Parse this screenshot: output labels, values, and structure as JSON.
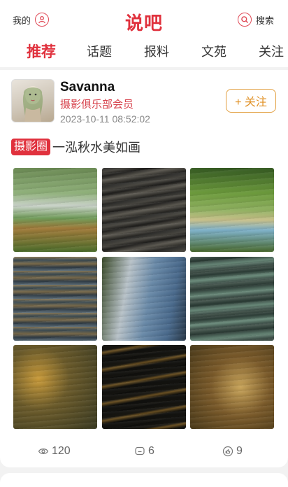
{
  "header": {
    "my_label": "我的",
    "title": "说吧",
    "search_label": "搜索",
    "accent_color": "#e0313d"
  },
  "tabs": [
    {
      "label": "推荐",
      "active": true
    },
    {
      "label": "话题",
      "active": false
    },
    {
      "label": "报料",
      "active": false
    },
    {
      "label": "文苑",
      "active": false
    },
    {
      "label": "关注",
      "active": false
    }
  ],
  "post": {
    "author": {
      "name": "Savanna",
      "role": "摄影俱乐部会员",
      "time": "2023-10-11 08:52:02"
    },
    "follow_label": "+ 关注",
    "tag": "摄影圈",
    "title": "一泓秋水美如画",
    "photos": [
      {
        "icon": "water-reflection-photo"
      },
      {
        "icon": "dark-ripple-photo"
      },
      {
        "icon": "green-reflection-photo"
      },
      {
        "icon": "rippled-reflection-photo"
      },
      {
        "icon": "building-reflection-photo"
      },
      {
        "icon": "teal-water-photo"
      },
      {
        "icon": "pebble-bed-photo"
      },
      {
        "icon": "night-ripple-photo"
      },
      {
        "icon": "riverbed-stones-photo"
      }
    ],
    "stats": {
      "views": "120",
      "comments": "6",
      "likes": "9"
    }
  }
}
